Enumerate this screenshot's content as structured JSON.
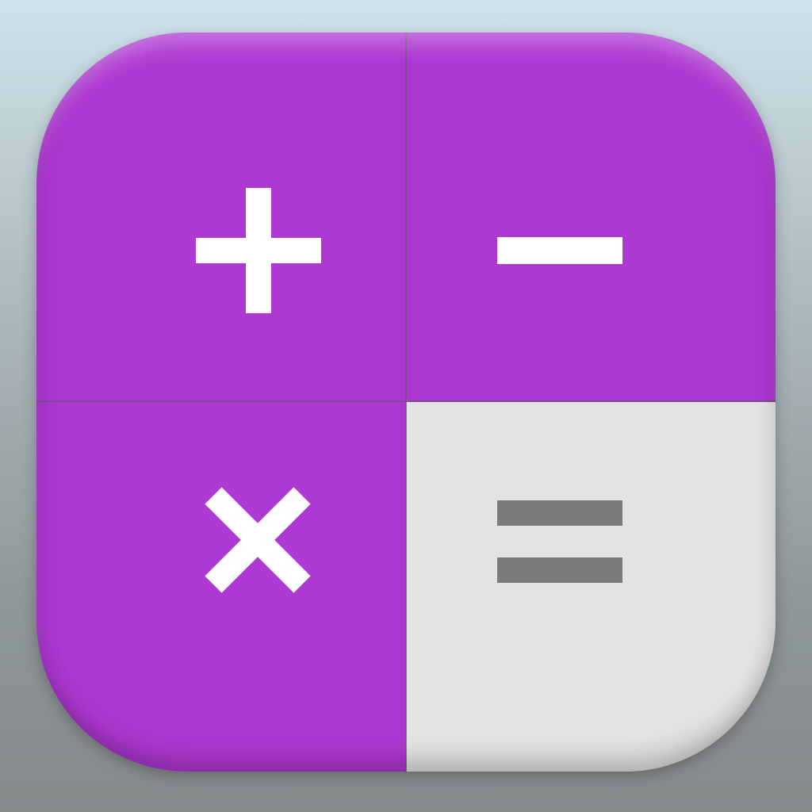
{
  "icon": {
    "colors": {
      "operator_tile": "#ae38d2",
      "equals_tile": "#e3e3e3",
      "operator_glyph": "#ffffff",
      "equals_glyph": "#7b7b7b"
    },
    "tiles": [
      {
        "name": "plus",
        "icon": "plus-icon"
      },
      {
        "name": "minus",
        "icon": "minus-icon"
      },
      {
        "name": "times",
        "icon": "multiply-icon"
      },
      {
        "name": "equals",
        "icon": "equals-icon"
      }
    ]
  }
}
